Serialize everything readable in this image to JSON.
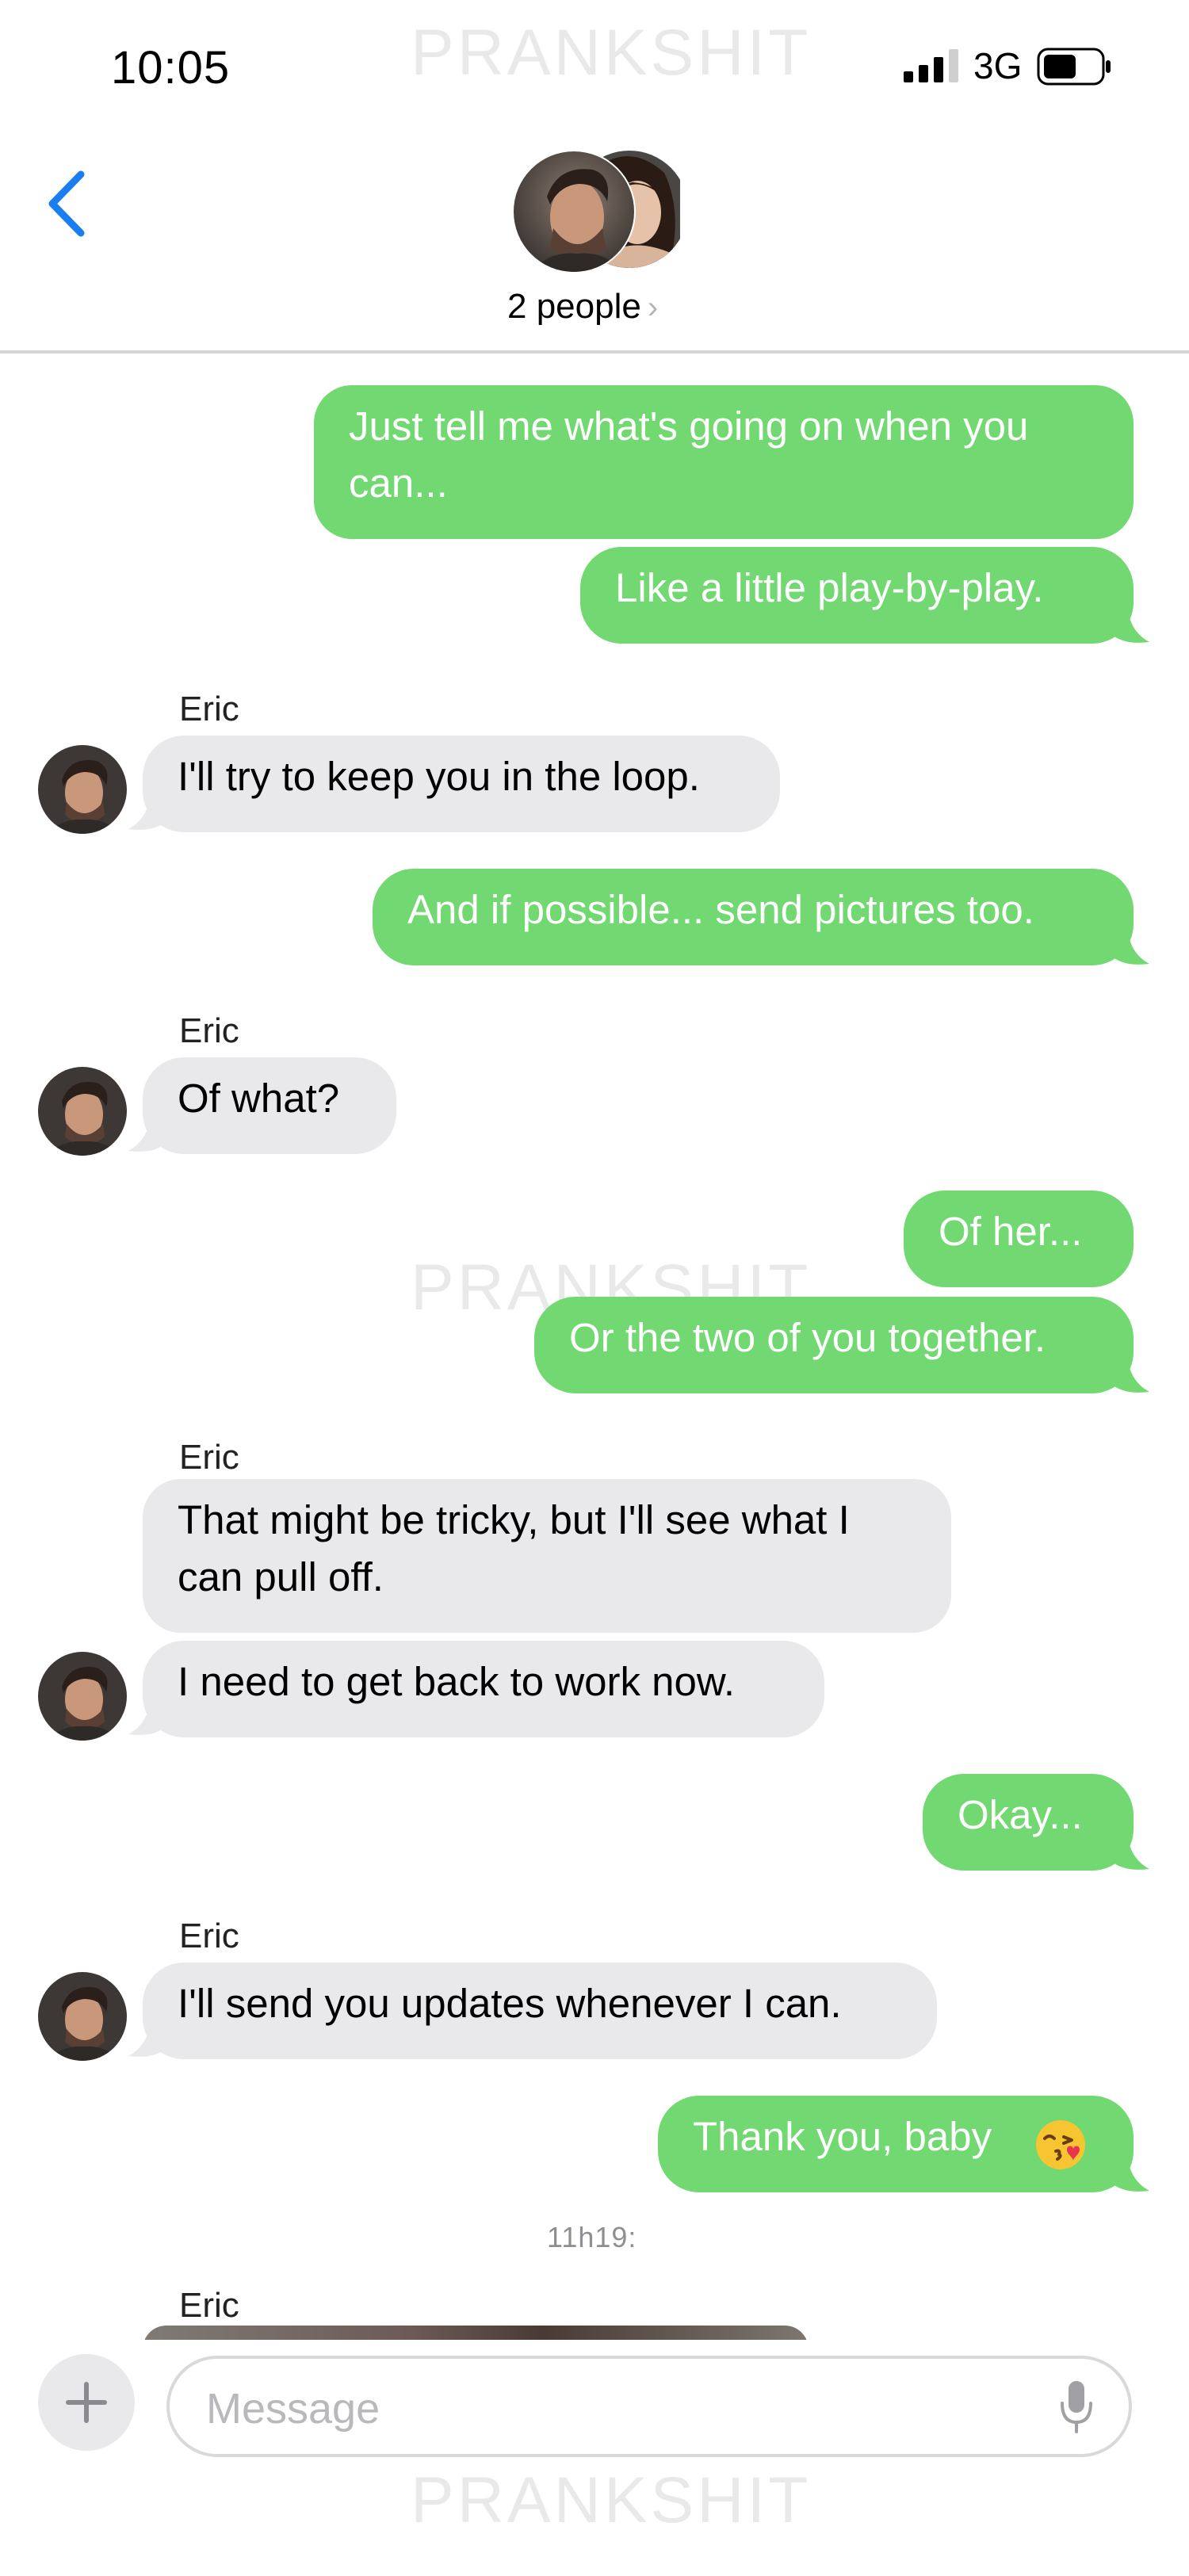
{
  "status_bar": {
    "time": "10:05",
    "network": "3G"
  },
  "watermark": "PRANKSHIT",
  "header": {
    "participants_label": "2 people",
    "chevron": "›"
  },
  "messages": [
    {
      "direction": "sent",
      "text_lines": [
        "Just tell me what's going on when you",
        "can..."
      ]
    },
    {
      "direction": "sent",
      "text": "Like a little play-by-play."
    },
    {
      "direction": "received",
      "sender": "Eric",
      "text": "I'll try to keep you in the loop."
    },
    {
      "direction": "sent",
      "text": "And if possible... send pictures too."
    },
    {
      "direction": "received",
      "sender": "Eric",
      "text": "Of what?"
    },
    {
      "direction": "sent",
      "text": "Of her..."
    },
    {
      "direction": "sent",
      "text": "Or the two of you together."
    },
    {
      "direction": "received",
      "sender": "Eric",
      "text_lines": [
        "That might be tricky, but I'll see what I",
        "can pull off."
      ]
    },
    {
      "direction": "received",
      "text": "I need to get back to work now."
    },
    {
      "direction": "sent",
      "text": "Okay..."
    },
    {
      "direction": "received",
      "sender": "Eric",
      "text": "I'll send you updates whenever I can."
    },
    {
      "direction": "sent",
      "text": "Thank you, baby",
      "emoji": "kissing-face-with-heart"
    },
    {
      "direction": "timestamp",
      "text": "11h19:"
    },
    {
      "direction": "received",
      "sender": "Eric",
      "attachment": "image"
    }
  ],
  "composer": {
    "placeholder": "Message",
    "plus": "+"
  },
  "colors": {
    "sent_bubble": "#72d871",
    "received_bubble": "#e9e9eb",
    "accent": "#1a7ef0"
  },
  "icons": {
    "back": "chevron-left-icon",
    "mic": "microphone-icon",
    "plus": "plus-icon"
  }
}
